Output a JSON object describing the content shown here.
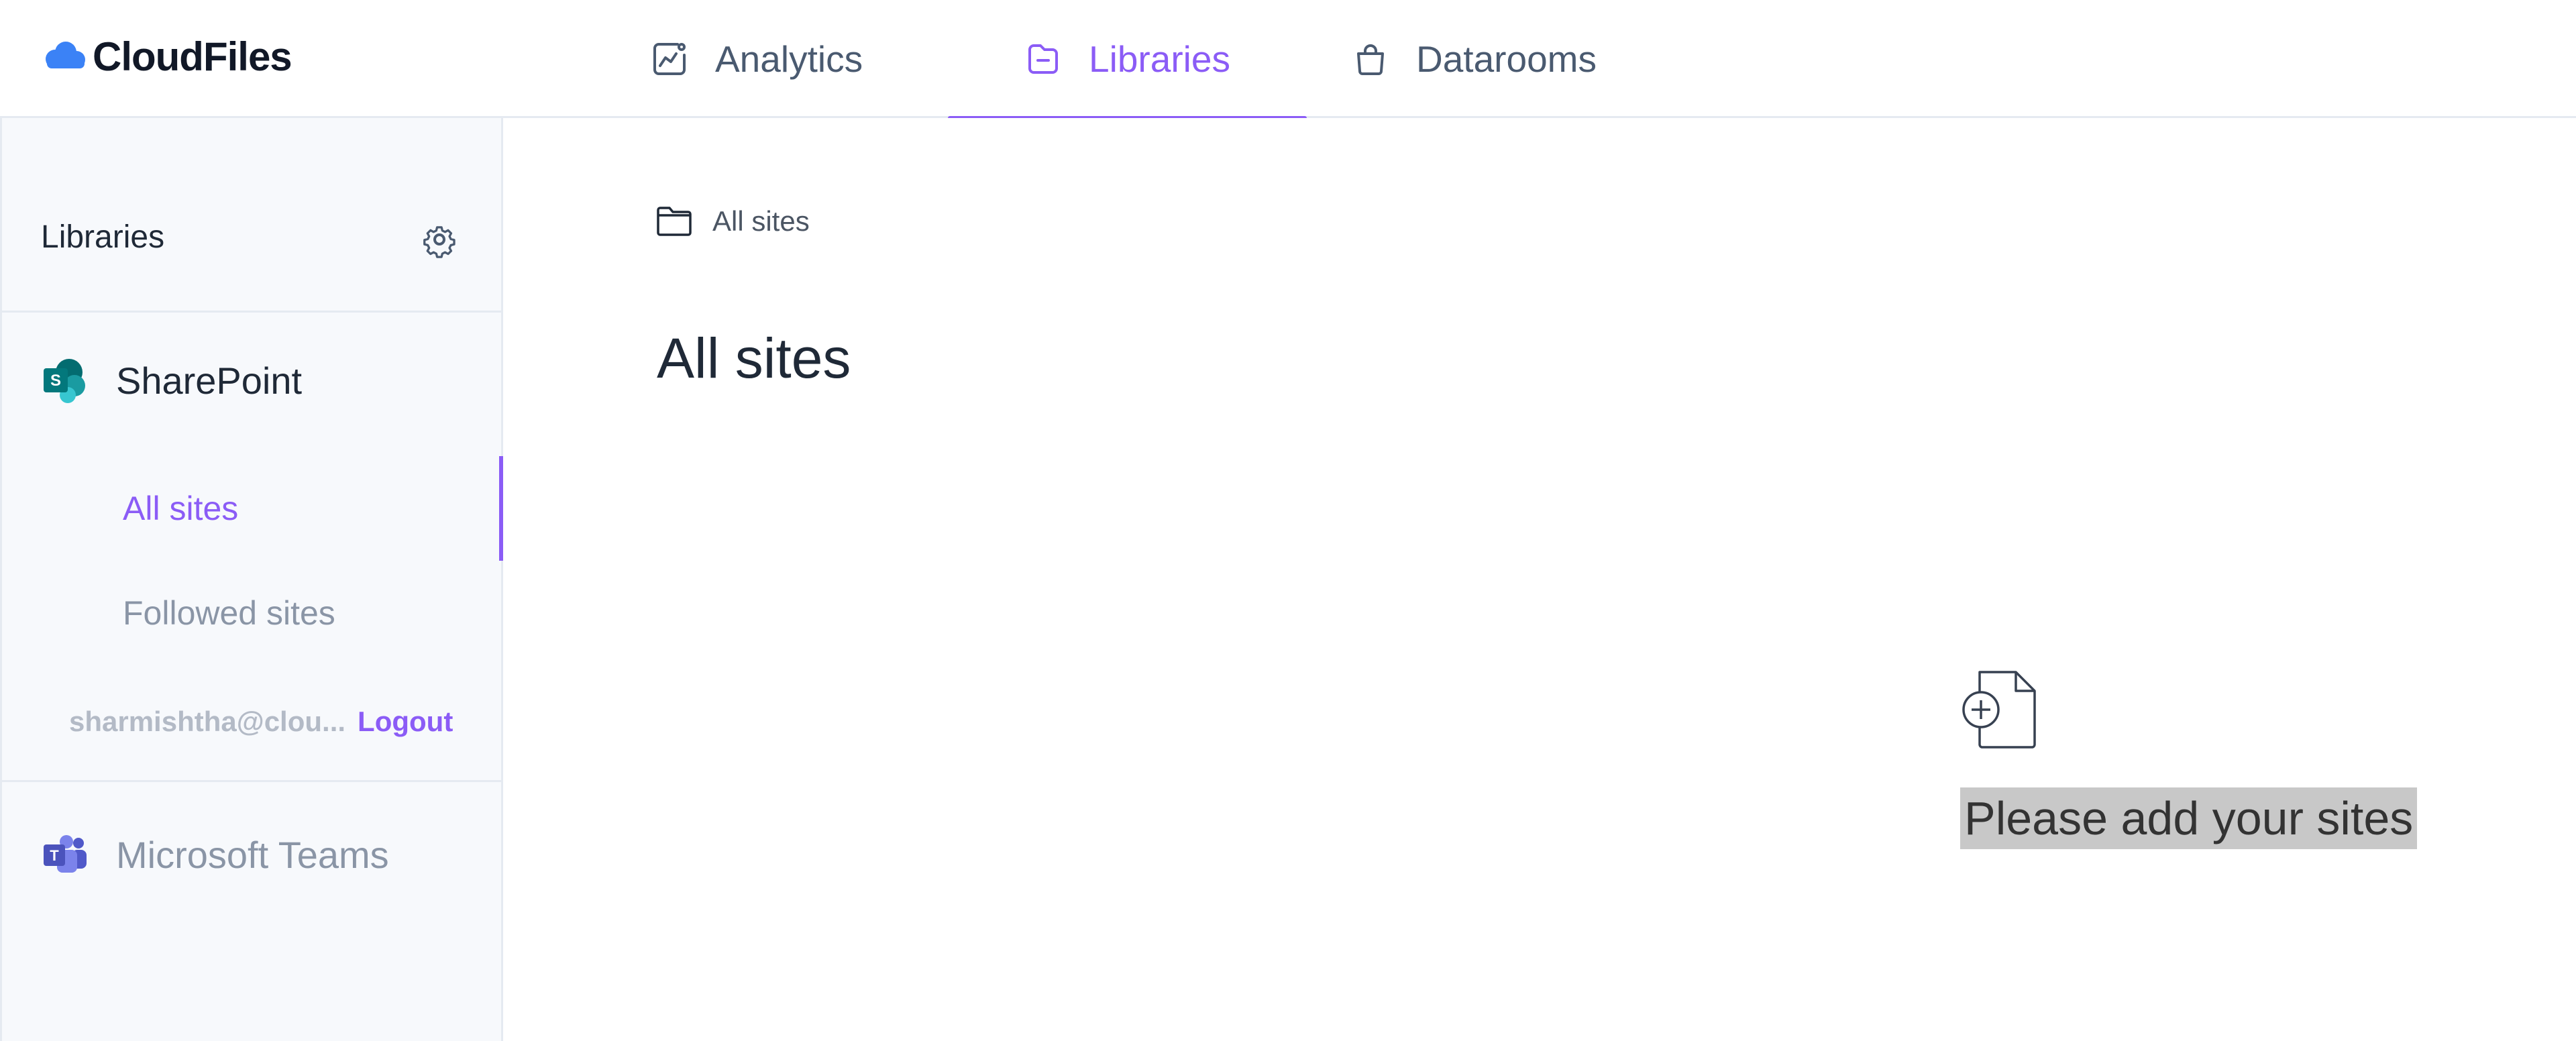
{
  "app": {
    "name": "CloudFiles",
    "brand_color": "#8b5cf6",
    "logo_color": "#3b82f6"
  },
  "header": {
    "tabs": [
      {
        "label": "Analytics",
        "icon": "chart-icon",
        "active": false
      },
      {
        "label": "Libraries",
        "icon": "library-icon",
        "active": true
      },
      {
        "label": "Datarooms",
        "icon": "bag-icon",
        "active": false
      }
    ]
  },
  "sidebar": {
    "title": "Libraries",
    "settings_icon": "gear-icon",
    "providers": [
      {
        "name": "SharePoint",
        "icon": "sharepoint-icon",
        "items": [
          {
            "label": "All sites",
            "active": true
          },
          {
            "label": "Followed sites",
            "active": false
          }
        ],
        "account": {
          "email": "sharmishtha@clou...",
          "logout_label": "Logout"
        }
      },
      {
        "name": "Microsoft Teams",
        "icon": "teams-icon"
      }
    ]
  },
  "main": {
    "breadcrumb": {
      "icon": "folder-icon",
      "label": "All sites"
    },
    "title": "All sites",
    "empty_state": {
      "icon": "add-file-icon",
      "message": "Please add your sites"
    }
  }
}
